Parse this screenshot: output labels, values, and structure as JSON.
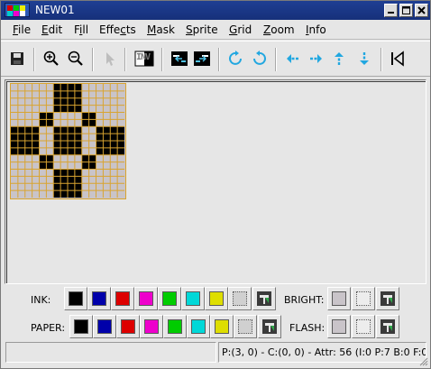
{
  "window": {
    "title": "NEW01"
  },
  "menu": {
    "items": [
      {
        "pre": "",
        "key": "F",
        "post": "ile"
      },
      {
        "pre": "",
        "key": "E",
        "post": "dit"
      },
      {
        "pre": "F",
        "key": "i",
        "post": "ll"
      },
      {
        "pre": "Effe",
        "key": "c",
        "post": "ts"
      },
      {
        "pre": "",
        "key": "M",
        "post": "ask"
      },
      {
        "pre": "",
        "key": "S",
        "post": "prite"
      },
      {
        "pre": "",
        "key": "G",
        "post": "rid"
      },
      {
        "pre": "",
        "key": "Z",
        "post": "oom"
      },
      {
        "pre": "",
        "key": "I",
        "post": "nfo"
      }
    ]
  },
  "toolbar": {
    "icons": [
      "save-icon",
      "zoom-in-icon",
      "zoom-out-icon",
      "pointer-icon",
      "invert-icon",
      "swap-left-icon",
      "swap-right-icon",
      "rotate-clockwise-icon",
      "rotate-counterclockwise-icon",
      "shift-left-icon",
      "shift-right-icon",
      "shift-up-icon",
      "shift-down-icon",
      "flip-icon"
    ],
    "invert_label": "INV"
  },
  "sprite": {
    "size": 8,
    "ink_color": "#000000",
    "paper_color": "#c9c4c9",
    "grid_color": "#d9a430",
    "rows": [
      "00011000",
      "00011000",
      "00100100",
      "11011011",
      "11011011",
      "00100100",
      "00011000",
      "00011000"
    ]
  },
  "ink": {
    "label": "INK:",
    "colors": [
      "#000000",
      "#0000aa",
      "#dd0000",
      "#ee00cc",
      "#00cc00",
      "#00d8d8",
      "#dede00",
      "#d0d0d0"
    ]
  },
  "paper": {
    "label": "PAPER:",
    "colors": [
      "#000000",
      "#0000aa",
      "#dd0000",
      "#ee00cc",
      "#00cc00",
      "#00d8d8",
      "#dede00",
      "#d0d0d0"
    ]
  },
  "bright": {
    "label": "BRIGHT:"
  },
  "flash": {
    "label": "FLASH:"
  },
  "status": {
    "left": "",
    "right": "P:(3, 0) - C:(0, 0) - Attr: 56 (I:0 P:7 B:0 F:0)"
  }
}
